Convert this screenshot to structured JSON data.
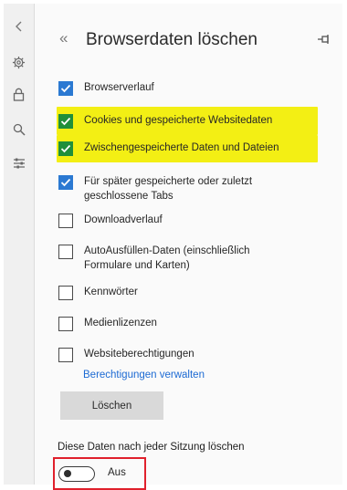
{
  "panel": {
    "title": "Browserdaten löschen",
    "back_glyph": "«",
    "pin_icon": "pin-icon"
  },
  "rail": {
    "items": [
      "chevron-left-icon",
      "gear-icon",
      "lock-icon",
      "search-icon",
      "sliders-icon"
    ]
  },
  "options": [
    {
      "label": "Browserverlauf",
      "checked": true,
      "highlighted": false
    },
    {
      "label": "Cookies und gespeicherte Websitedaten",
      "checked": true,
      "highlighted": true
    },
    {
      "label": "Zwischengespeicherte Daten und Dateien",
      "checked": true,
      "highlighted": true
    },
    {
      "label": "Für später gespeicherte oder zuletzt geschlossene Tabs",
      "checked": true,
      "highlighted": false
    },
    {
      "label": "Downloadverlauf",
      "checked": false,
      "highlighted": false
    },
    {
      "label": "AutoAusfüllen-Daten (einschließlich Formulare und Karten)",
      "checked": false,
      "highlighted": false
    },
    {
      "label": "Kennwörter",
      "checked": false,
      "highlighted": false
    },
    {
      "label": "Medienlizenzen",
      "checked": false,
      "highlighted": false
    },
    {
      "label": "Websiteberechtigungen",
      "checked": false,
      "highlighted": false
    }
  ],
  "manage_link": "Berechtigungen verwalten",
  "clear_button": "Löschen",
  "auto_clear": {
    "heading": "Diese Daten nach jeder Sitzung löschen",
    "toggle_state": "Aus",
    "enabled": false
  },
  "colors": {
    "checkbox_on": "#2b79d2",
    "checkbox_on_highlighted": "#1f8f3a",
    "highlight": "#f3ef14",
    "link": "#1c6ad3",
    "callout_border": "#e0202c"
  }
}
